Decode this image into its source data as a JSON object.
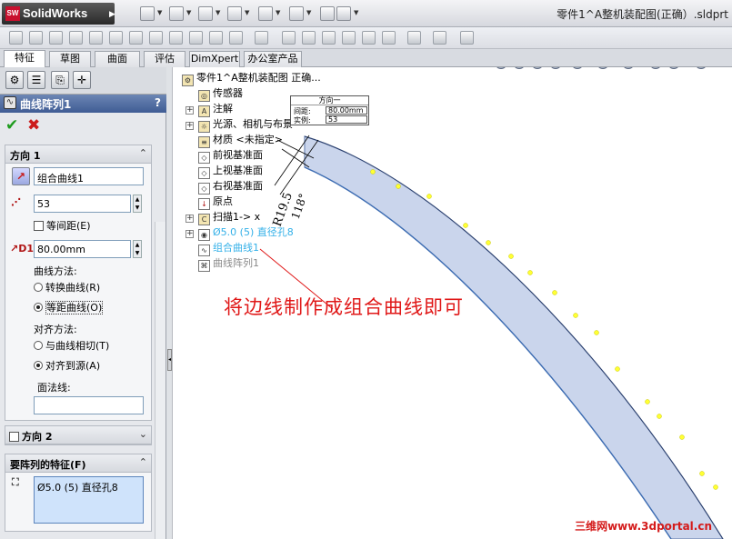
{
  "app": {
    "logo_text": "SolidWorks",
    "logo_badge": "SW",
    "document_title": "零件1^A整机装配图(正确）.sldprt"
  },
  "tabs": [
    {
      "label": "特征",
      "active": true
    },
    {
      "label": "草图"
    },
    {
      "label": "曲面"
    },
    {
      "label": "评估"
    },
    {
      "label": "DimXpert"
    },
    {
      "label": "办公室产品"
    }
  ],
  "property_manager": {
    "title": "曲线阵列1",
    "help": "?",
    "direction1": {
      "header": "方向 1",
      "reference_value": "组合曲线1",
      "instances_value": "53",
      "equal_spacing_label": "等间距(E)",
      "spacing_value": "80.00mm",
      "curve_method_label": "曲线方法:",
      "curve_method_options": [
        {
          "label": "转换曲线(R)",
          "selected": false
        },
        {
          "label": "等距曲线(O)",
          "selected": true
        }
      ],
      "alignment_label": "对齐方法:",
      "alignment_options": [
        {
          "label": "与曲线相切(T)",
          "selected": false
        },
        {
          "label": "对齐到源(A)",
          "selected": true
        }
      ],
      "face_normal_label": "面法线:",
      "face_normal_value": ""
    },
    "direction2": {
      "header": "方向 2"
    },
    "features_to_pattern": {
      "header": "要阵列的特征(F)",
      "items": [
        "Ø5.0 (5) 直径孔8"
      ]
    }
  },
  "feature_tree": {
    "root": "零件1^A整机装配图 正确...",
    "items": [
      {
        "label": "传感器",
        "icon": "sensor-icon"
      },
      {
        "label": "注解",
        "icon": "annotation-icon"
      },
      {
        "label": "光源、相机与布景",
        "icon": "light-icon"
      },
      {
        "label": "材质 <未指定>",
        "icon": "material-icon"
      },
      {
        "label": "前视基准面",
        "icon": "plane-icon"
      },
      {
        "label": "上视基准面",
        "icon": "plane-icon"
      },
      {
        "label": "右视基准面",
        "icon": "plane-icon"
      },
      {
        "label": "原点",
        "icon": "origin-icon"
      },
      {
        "label": "扫描1-> x",
        "icon": "sweep-icon"
      },
      {
        "label": "Ø5.0 (5) 直径孔8",
        "icon": "hole-icon"
      },
      {
        "label": "组合曲线1",
        "icon": "curve-icon"
      },
      {
        "label": "曲线阵列1",
        "icon": "pattern-icon"
      }
    ]
  },
  "callout": {
    "title": "方向一",
    "spacing_label": "间距:",
    "spacing_value": "80.00mm",
    "instances_label": "实例:",
    "instances_value": "53"
  },
  "annotation_text": "将边线制作成组合曲线即可",
  "watermark": "三维网www.3dportal.cn",
  "colors": {
    "accent_header": "#3f5c94",
    "annotation": "#e01818",
    "body_fill": "#c9d4ea",
    "point_marker": "#ffff33"
  }
}
